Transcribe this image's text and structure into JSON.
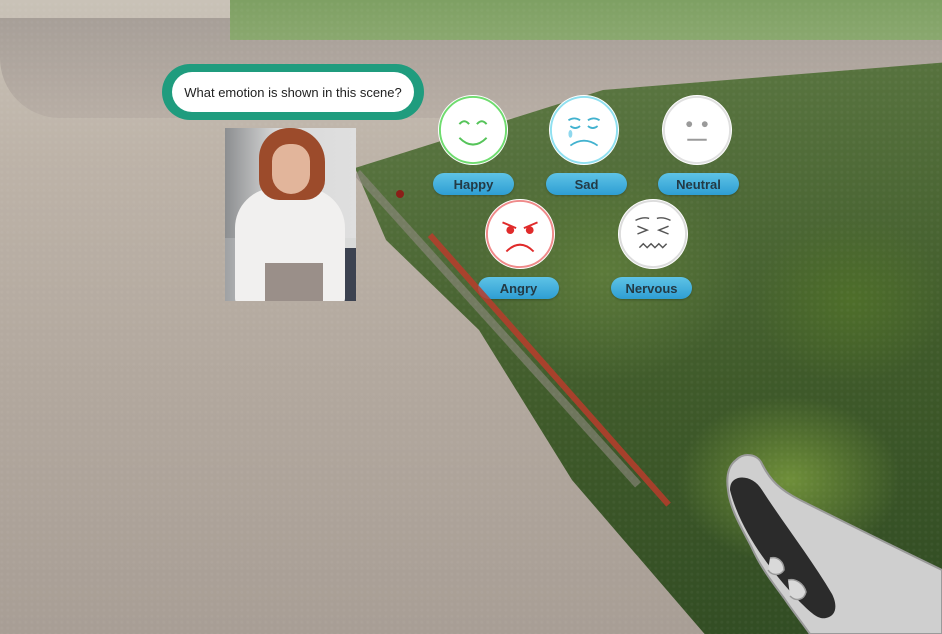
{
  "question": {
    "text": "What emotion is shown in this scene?"
  },
  "emotions": [
    {
      "label": "Happy",
      "color": "#56c45a"
    },
    {
      "label": "Sad",
      "color": "#42b2cf"
    },
    {
      "label": "Neutral",
      "color": "#9a9a9a"
    },
    {
      "label": "Angry",
      "color": "#e02b2b"
    },
    {
      "label": "Nervous",
      "color": "#555555"
    }
  ],
  "colors": {
    "bubble": "#1f9c7e",
    "pill": "#2e9ed3",
    "ray": "#b83c2c"
  },
  "icons": [
    "happy-face-icon",
    "sad-face-icon",
    "neutral-face-icon",
    "angry-face-icon",
    "nervous-face-icon",
    "vr-controller-hand-icon"
  ]
}
